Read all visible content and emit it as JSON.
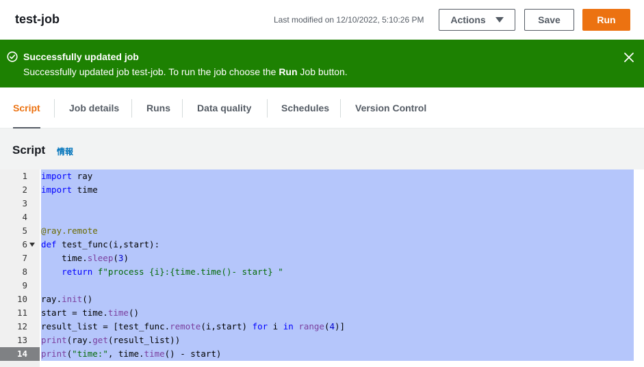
{
  "header": {
    "job_title": "test-job",
    "last_modified": "Last modified on 12/10/2022, 5:10:26 PM",
    "actions_label": "Actions",
    "save_label": "Save",
    "run_label": "Run"
  },
  "banner": {
    "title": "Successfully updated job",
    "message_prefix": "Successfully updated job test-job. To run the job choose the ",
    "message_bold": "Run",
    "message_suffix": " Job button.",
    "color": "#1d8102"
  },
  "tabs": [
    {
      "label": "Script",
      "active": true
    },
    {
      "label": "Job details",
      "active": false
    },
    {
      "label": "Runs",
      "active": false
    },
    {
      "label": "Data quality",
      "active": false
    },
    {
      "label": "Schedules",
      "active": false
    },
    {
      "label": "Version Control",
      "active": false
    }
  ],
  "section": {
    "title": "Script",
    "info_link": "情報"
  },
  "editor": {
    "line_numbers": [
      "1",
      "2",
      "3",
      "4",
      "5",
      "6",
      "7",
      "8",
      "9",
      "10",
      "11",
      "12",
      "13",
      "14"
    ],
    "current_line": "14",
    "selection_color": "#b5c6fb",
    "code_lines": [
      "import ray",
      "import time",
      "",
      "",
      "@ray.remote",
      "def test_func(i,start):",
      "    time.sleep(3)",
      "    return f\"process {i}:{time.time()- start} \"",
      "",
      "ray.init()",
      "start = time.time()",
      "result_list = [test_func.remote(i,start) for i in range(4)]",
      "print(ray.get(result_list))",
      "print(\"time:\", time.time() - start)"
    ]
  },
  "colors": {
    "accent": "#ec7211",
    "link": "#0073bb"
  }
}
